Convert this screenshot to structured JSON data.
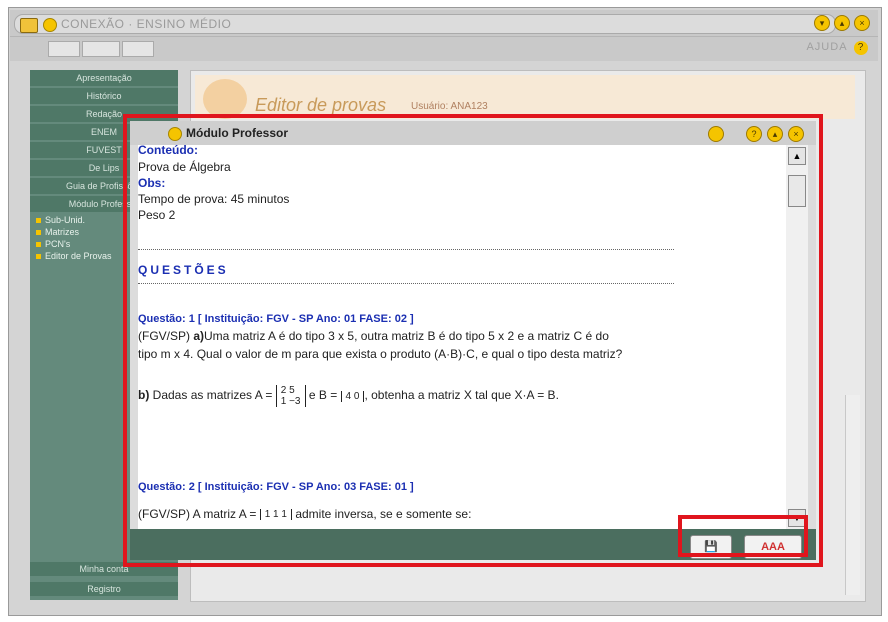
{
  "app": {
    "title": "CONEXÃO · ENSINO MÉDIO",
    "help_label": "AJUDA",
    "help_icon": "?"
  },
  "sidebar": {
    "items": [
      "Apresentação",
      "Histórico",
      "Redação",
      "ENEM",
      "FUVEST",
      "De Lips",
      "Guia de Profissões",
      "Módulo Professor"
    ],
    "subitems": [
      "Sub-Unid.",
      "Matrizes",
      "PCN's",
      "Editor de Provas"
    ],
    "bottom": [
      "Minha conta",
      "Registro"
    ]
  },
  "editor": {
    "banner_title": "Editor de provas",
    "user_label": "Usuário: ANA123"
  },
  "modal": {
    "title": "Módulo Professor",
    "conteudo_label": "Conteúdo:",
    "conteudo_value": "Prova de Álgebra",
    "obs_label": "Obs:",
    "obs_line1": "Tempo de prova: 45 minutos",
    "obs_line2": "Peso 2",
    "questoes_heading": "QUESTÕES",
    "q1_header": "Questão: 1 [ Instituição: FGV - SP Ano: 01 FASE: 02 ]",
    "q1_prefix": "(FGV/SP) ",
    "q1_a_label": "a)",
    "q1_a_text": "Uma matriz A é do tipo 3 x 5, outra matriz B é do tipo 5 x 2 e a matriz C é do",
    "q1_a_text2": "tipo m x 4. Qual o valor de m para que exista o produto (A·B)·C, e qual o tipo desta matriz?",
    "q1_b_label": "b)",
    "q1_b_text1": "Dadas as matrizes  A =",
    "q1_b_text2": "e  B =",
    "q1_b_text3": ", obtenha a matriz X tal que X·A = B.",
    "matrix_a_row1": "2  5",
    "matrix_a_row2": "1 −3",
    "matrix_b_row1": "4  0",
    "q2_header": "Questão: 2 [ Instituição: FGV - SP Ano: 03 FASE: 01 ]",
    "q2_text": "(FGV/SP) A matriz   A =",
    "q2_matrix_row1": "1   1   1",
    "q2_text_after": "admite inversa, se e somente se:"
  },
  "footer": {
    "save_label": "💾",
    "font_size_label": "AAA"
  }
}
